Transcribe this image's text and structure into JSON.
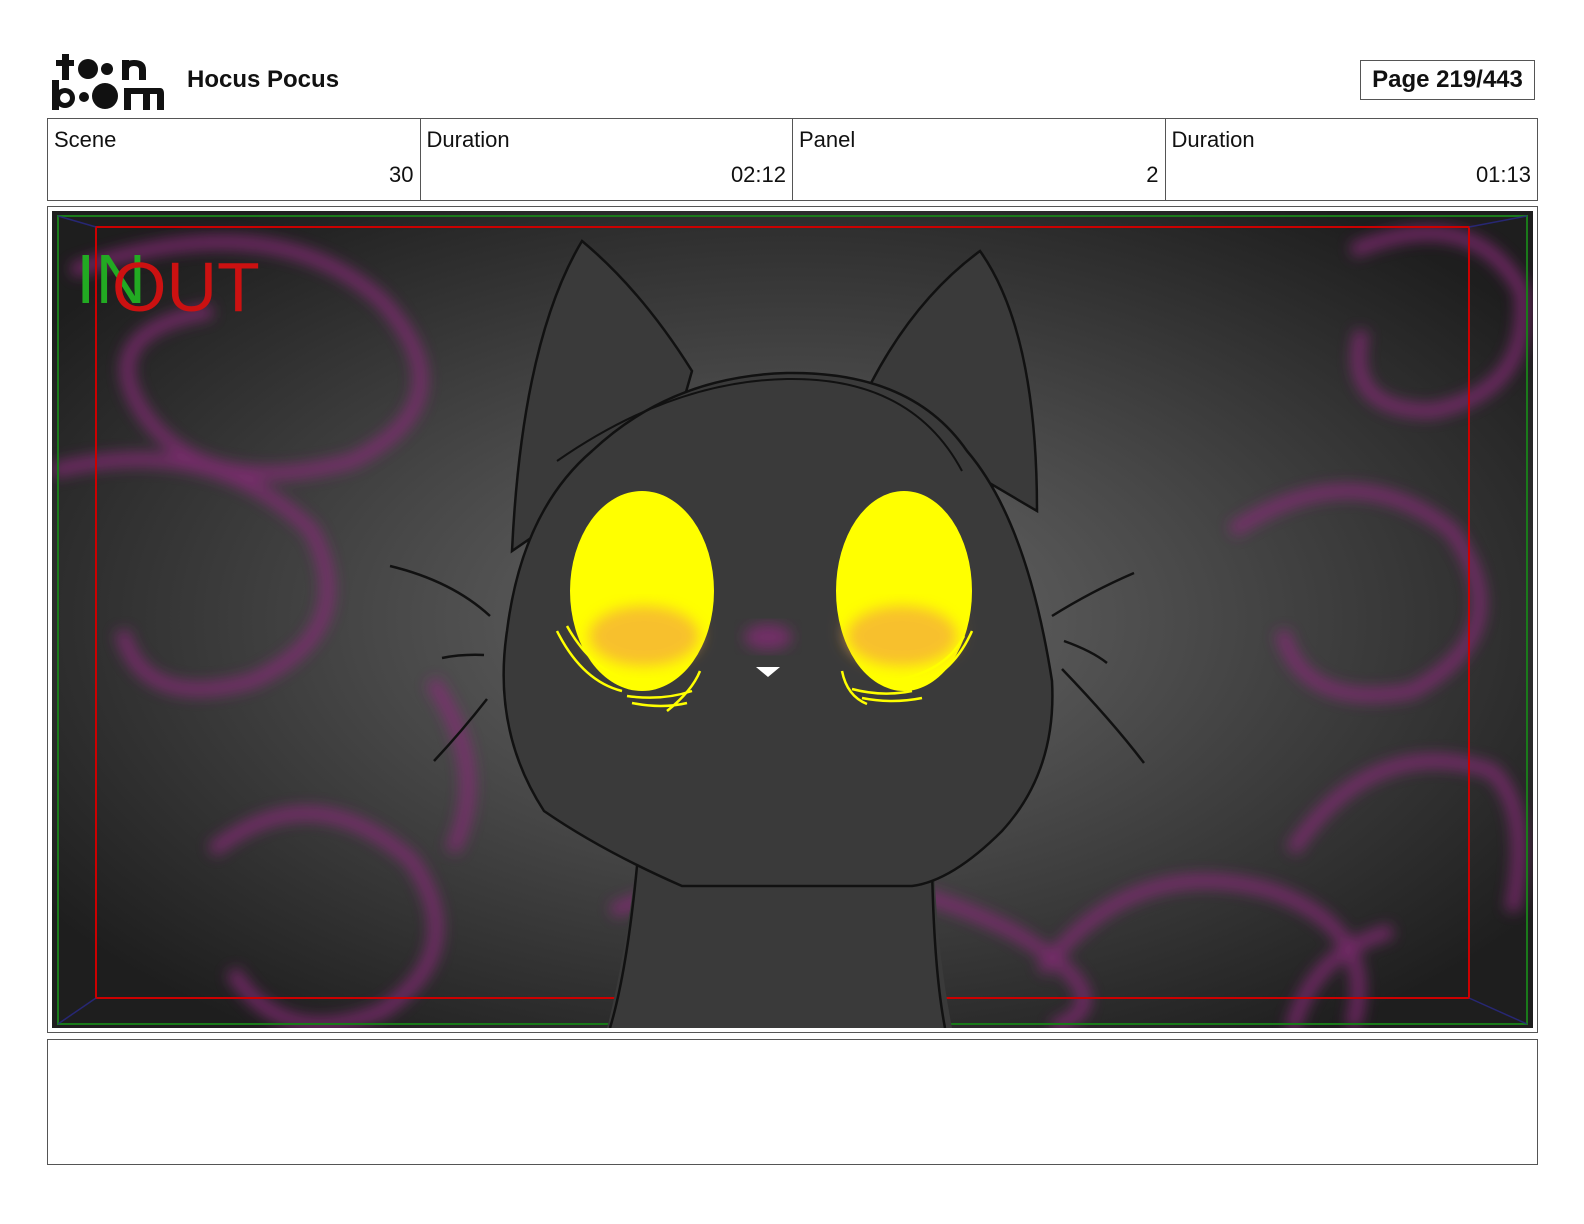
{
  "header": {
    "logo_top": "t●●n",
    "logo_bottom": "b●●m",
    "project_title": "Hocus Pocus",
    "page_label": "Page 219/443"
  },
  "info": [
    {
      "label": "Scene",
      "value": "30"
    },
    {
      "label": "Duration",
      "value": "02:12"
    },
    {
      "label": "Panel",
      "value": "2"
    },
    {
      "label": "Duration",
      "value": "01:13"
    }
  ],
  "panel": {
    "in_marker": "IN",
    "out_marker": "OUT",
    "safe_frame_color": "#1a7a1a",
    "action_frame_color": "#cc0000",
    "in_color": "#22aa22",
    "out_color": "#cc1111",
    "eye_color": "#ffff00",
    "blush_color": "#f4a640",
    "glow_color": "#8a2a7a"
  },
  "notes": {
    "text": ""
  }
}
